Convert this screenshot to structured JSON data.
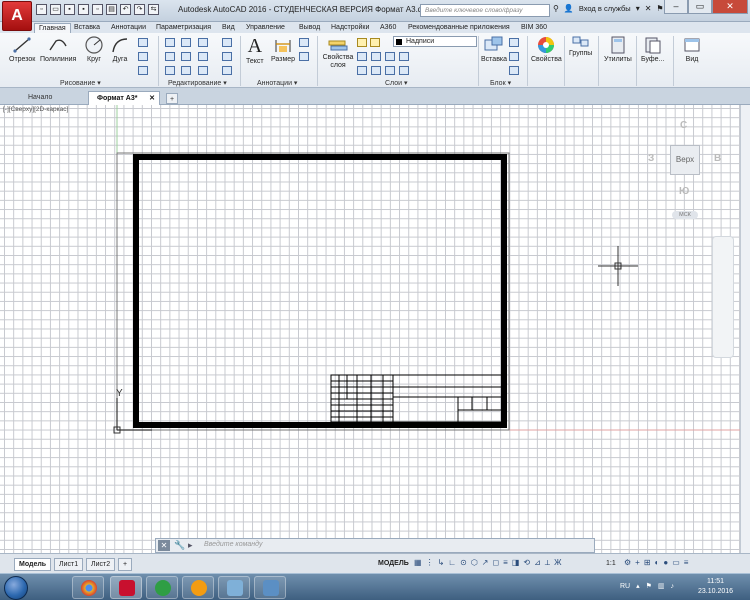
{
  "window": {
    "title": "Autodesk AutoCAD 2016 - СТУДЕНЧЕСКАЯ ВЕРСИЯ    Формат А3.dwg",
    "search_placeholder": "Введите ключевое слово/фразу",
    "signin": "Вход в службы",
    "app_letter": "A"
  },
  "ribbon_tabs": [
    "Главная",
    "Вставка",
    "Аннотации",
    "Параметризация",
    "Вид",
    "Управление",
    "Вывод",
    "Надстройки",
    "A360",
    "Рекомендованные приложения",
    "BIM 360"
  ],
  "ribbon": {
    "draw": {
      "line": "Отрезок",
      "polyline": "Полилиния",
      "circle": "Круг",
      "arc": "Дуга",
      "panel": "Рисование ▾"
    },
    "modify": {
      "panel": "Редактирование ▾"
    },
    "annotation": {
      "text": "Текст",
      "dimension": "Размер",
      "panel": "Аннотации ▾"
    },
    "layers": {
      "properties": "Свойства слоя",
      "current_layer": "Надписи",
      "panel": "Слои ▾"
    },
    "block": {
      "insert": "Вставка",
      "panel": "Блок ▾"
    },
    "properties": {
      "label": "Свойства"
    },
    "groups": {
      "label": "Группы"
    },
    "utilities": {
      "label": "Утилиты"
    },
    "clipboard": {
      "label": "Буфе..."
    },
    "view": {
      "label": "Вид"
    }
  },
  "doc_tabs": {
    "start": "Начало",
    "current": "Формат А3*",
    "add": "+"
  },
  "viewport": {
    "label": "[-][Сверху][2D-каркас]",
    "navcube": {
      "top": "Верх",
      "north": "С",
      "south": "Ю",
      "west": "З",
      "east": "В",
      "ucs": "МСК"
    },
    "axis_y": "Y"
  },
  "command": {
    "placeholder": "Введите команду",
    "close": "✕"
  },
  "status": {
    "layouts": [
      "Модель",
      "Лист1",
      "Лист2"
    ],
    "add_layout": "+",
    "mode": "МОДЕЛЬ",
    "scale": "1:1"
  },
  "taskbar": {
    "lang": "RU",
    "time": "11:51",
    "date": "23.10.2016",
    "colors": {
      "chrome": "#e8b12a",
      "autocad": "#c8102e",
      "app3": "#2f9e44",
      "app4": "#f39c12",
      "app5": "#7fb0d8",
      "app6": "#5b8fc4"
    }
  }
}
